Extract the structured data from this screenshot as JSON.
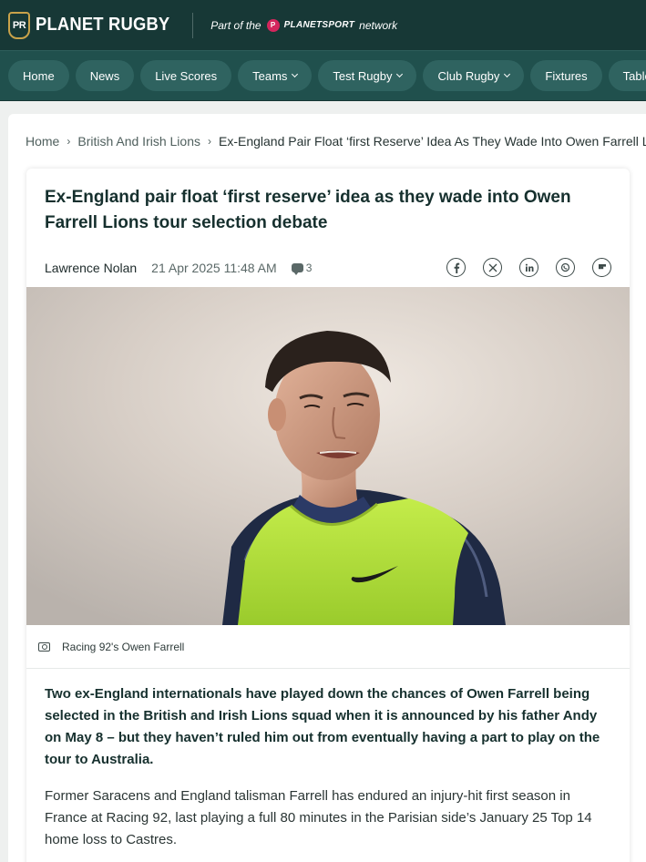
{
  "header": {
    "logo_badge": "PR",
    "logo_text": "PLANET RUGBY",
    "part_of_prefix": "Part of the",
    "network_brand_mark": "P",
    "network_brand": "PLANETSPORT",
    "part_of_suffix": "network"
  },
  "nav": {
    "items": [
      {
        "label": "Home",
        "dropdown": false
      },
      {
        "label": "News",
        "dropdown": false
      },
      {
        "label": "Live Scores",
        "dropdown": false
      },
      {
        "label": "Teams",
        "dropdown": true
      },
      {
        "label": "Test Rugby",
        "dropdown": true
      },
      {
        "label": "Club Rugby",
        "dropdown": true
      },
      {
        "label": "Fixtures",
        "dropdown": false
      },
      {
        "label": "Tables",
        "dropdown": false
      }
    ]
  },
  "breadcrumb": {
    "home": "Home",
    "section": "British And Irish Lions",
    "current": "Ex-England Pair Float ‘first Reserve’ Idea As They Wade Into Owen Farrell Lions Tour Selection Debate",
    "separator": "›"
  },
  "article": {
    "title": "Ex-England pair float ‘first reserve’ idea as they wade into Owen Farrell Lions tour selection debate",
    "author": "Lawrence Nolan",
    "date": "21 Apr 2025 11:48 AM",
    "comment_count": "3",
    "share_icons": [
      "facebook-icon",
      "x-icon",
      "linkedin-icon",
      "whatsapp-icon",
      "flipboard-icon"
    ],
    "image_caption": "Racing 92's Owen Farrell",
    "lead": "Two ex-England internationals have played down the chances of Owen Farrell being selected in the British and Irish Lions squad when it is announced by his father Andy on May 8 – but they haven’t ruled him out from eventually having a part to play on the tour to Australia.",
    "body": "Former Saracens and England talisman Farrell has endured an injury-hit first season in France at Racing 92, last playing a full 80 minutes in the Parisian side’s January 25 Top 14 home loss to Castres."
  },
  "colors": {
    "header_bg": "#173836",
    "nav_bg": "#20504d",
    "nav_pill": "#2f6360",
    "accent_gold": "#c9a24a",
    "planetsport_pink": "#d4265d",
    "bib_green": "#b5e03a"
  }
}
